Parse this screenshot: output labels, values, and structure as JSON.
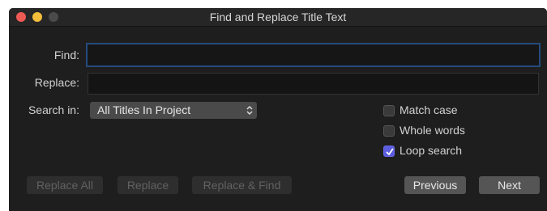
{
  "window": {
    "title": "Find and Replace Title Text"
  },
  "form": {
    "find_label": "Find:",
    "find_value": "",
    "replace_label": "Replace:",
    "replace_value": "",
    "search_in_label": "Search in:",
    "search_in_selected": "All Titles In Project"
  },
  "options": [
    {
      "label": "Match case",
      "checked": false
    },
    {
      "label": "Whole words",
      "checked": false
    },
    {
      "label": "Loop search",
      "checked": true
    }
  ],
  "buttons": {
    "replace_all": "Replace All",
    "replace": "Replace",
    "replace_find": "Replace & Find",
    "previous": "Previous",
    "next": "Next"
  },
  "colors": {
    "accent": "#5c5ce0",
    "focus_ring": "#244b7d",
    "window_bg": "#1e1e1e"
  },
  "icons": {
    "close": "close-traffic-light",
    "minimize": "minimize-traffic-light",
    "zoom": "zoom-traffic-light",
    "popup_chevron": "up-down-chevron-icon",
    "checkmark": "checkmark-icon"
  }
}
